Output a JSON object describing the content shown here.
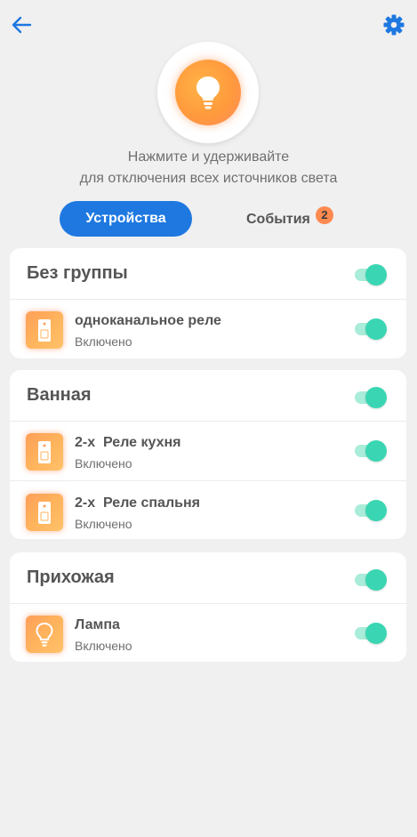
{
  "header": {
    "back_icon": "arrow-left-icon",
    "settings_icon": "gear-icon",
    "accent": "#1e78e0"
  },
  "master_switch": {
    "icon": "lightbulb-icon",
    "hint_line1": "Нажмите и удерживайте",
    "hint_line2": "для отключения всех источников света"
  },
  "tabs": [
    {
      "label": "Устройства",
      "active": true
    },
    {
      "label": "События",
      "badge": "2"
    }
  ],
  "groups": [
    {
      "title": "Без группы",
      "on": true,
      "devices": [
        {
          "name": "одноканальное реле",
          "status": "Включено",
          "icon": "relay-icon",
          "on": true
        }
      ]
    },
    {
      "title": "Ванная",
      "on": true,
      "devices": [
        {
          "name": "2-х  Реле кухня",
          "status": "Включено",
          "icon": "relay-icon",
          "on": true
        },
        {
          "name": "2-х  Реле спальня",
          "status": "Включено",
          "icon": "relay-icon",
          "on": true
        }
      ]
    },
    {
      "title": "Прихожая",
      "on": true,
      "devices": [
        {
          "name": "Лампа",
          "status": "Включено",
          "icon": "lamp-icon",
          "on": true
        }
      ]
    }
  ],
  "colors": {
    "toggle_on": "#3ad6b3",
    "badge": "#ff8a50",
    "device_icon": "#ffb35c"
  }
}
